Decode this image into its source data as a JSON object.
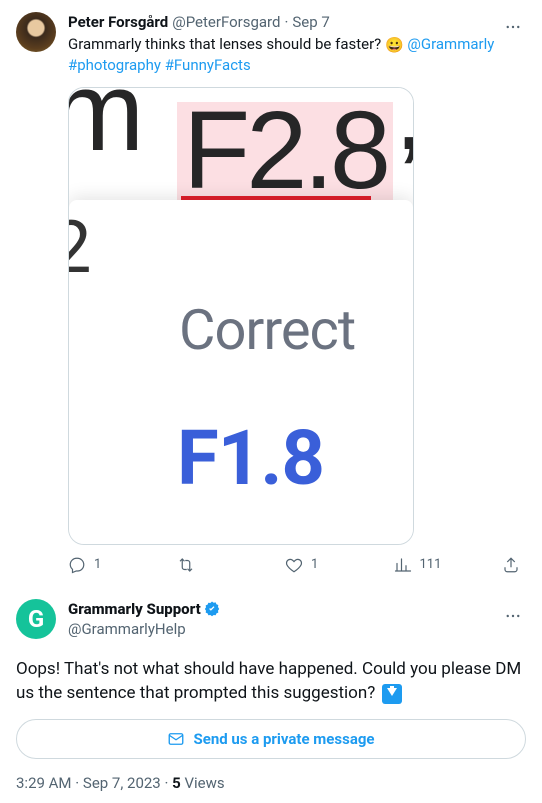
{
  "quoted": {
    "author_name": "Peter Forsgård",
    "author_handle": "@PeterForsgard",
    "date": "Sep 7",
    "text_before_emoji": "Grammarly thinks that lenses should be faster? ",
    "emoji": "😀",
    "mention": "@Grammarly",
    "hashtag1": "#photography",
    "hashtag2": "#FunnyFacts",
    "image": {
      "partial_left": "m",
      "highlighted": "F2.8",
      "trailing": ",",
      "stray_digit": "2",
      "suggestion_label": "Correct",
      "suggestion_value": "F1.8"
    },
    "actions": {
      "reply_count": "1",
      "retweet_count": "",
      "like_count": "1",
      "view_count": "111"
    }
  },
  "reply": {
    "author_name": "Grammarly Support",
    "author_handle": "@GrammarlyHelp",
    "text": "Oops! That's not what should have happened. Could you please DM us the sentence that prompted this suggestion? ",
    "dm_button": "Send us a private message",
    "time": "3:29 AM",
    "date": "Sep 7, 2023",
    "views_count": "5",
    "views_label": "Views"
  }
}
